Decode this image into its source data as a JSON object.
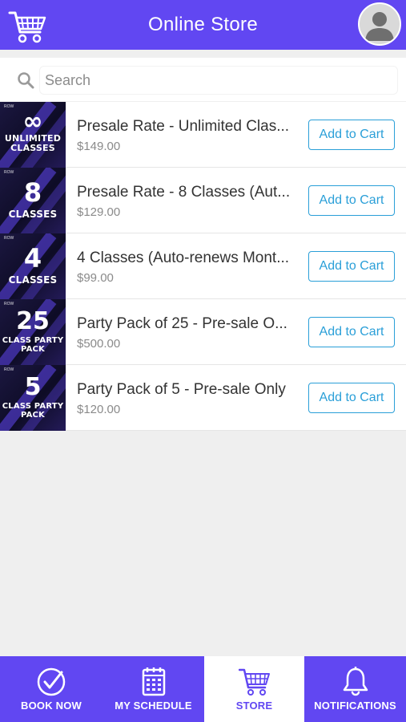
{
  "header": {
    "title": "Online Store"
  },
  "search": {
    "placeholder": "Search"
  },
  "products": [
    {
      "thumb_big": "∞",
      "thumb_small": [
        "UNLIMITED",
        "CLASSES"
      ],
      "name": "Presale Rate - Unlimited Clas...",
      "price": "$149.00",
      "button": "Add to Cart"
    },
    {
      "thumb_big": "8",
      "thumb_small": [
        "CLASSES"
      ],
      "name": "Presale Rate - 8 Classes (Aut...",
      "price": "$129.00",
      "button": "Add to Cart"
    },
    {
      "thumb_big": "4",
      "thumb_small": [
        "CLASSES"
      ],
      "name": "4 Classes (Auto-renews Mont...",
      "price": "$99.00",
      "button": "Add to Cart"
    },
    {
      "thumb_big": "25",
      "thumb_small": [
        "CLASS PARTY",
        "PACK"
      ],
      "name": "Party Pack of 25 - Pre-sale O...",
      "price": "$500.00",
      "button": "Add to Cart"
    },
    {
      "thumb_big": "5",
      "thumb_small": [
        "CLASS PARTY",
        "PACK"
      ],
      "name": "Party Pack of 5 - Pre-sale Only",
      "price": "$120.00",
      "button": "Add to Cart"
    }
  ],
  "tabs": [
    {
      "label": "BOOK NOW",
      "icon": "check-circle-icon",
      "active": false
    },
    {
      "label": "MY SCHEDULE",
      "icon": "calendar-icon",
      "active": false
    },
    {
      "label": "STORE",
      "icon": "cart-icon",
      "active": true
    },
    {
      "label": "NOTIFICATIONS",
      "icon": "bell-icon",
      "active": false
    }
  ],
  "colors": {
    "primary": "#6147f2",
    "button_accent": "#2a9fd8",
    "thumbnail_bg": "#1b1740"
  }
}
